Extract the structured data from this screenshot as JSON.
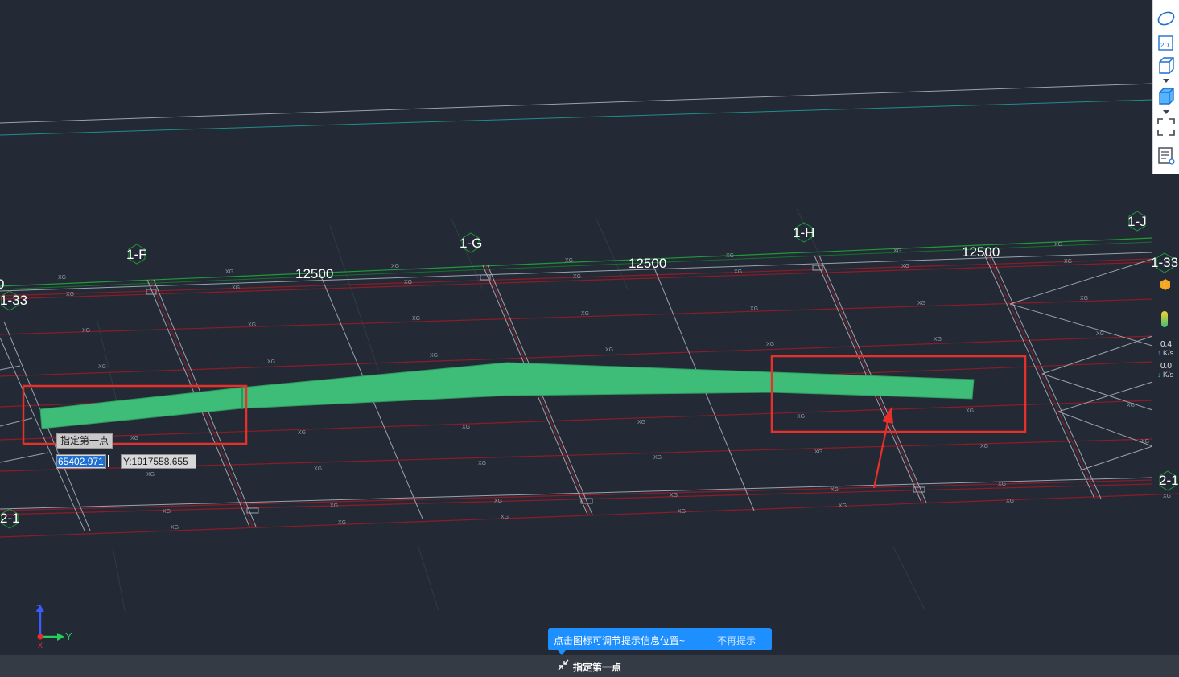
{
  "grid_labels": {
    "col_f": "1-F",
    "col_g": "1-G",
    "col_h": "1-H",
    "col_j": "1-J",
    "row_33_left": "1-33",
    "row_33_right": "1-33",
    "row_21_left": "2-1",
    "row_21_right": "2-1",
    "edge_left": "0"
  },
  "dimensions": [
    "12500",
    "12500",
    "12500"
  ],
  "member_label": "XG",
  "speed": {
    "up_value": "0.4",
    "up_unit": "K/s",
    "down_value": "0.0",
    "down_unit": "K/s"
  },
  "dynamic_input": {
    "prompt": "指定第一点",
    "x_value": "65402.971",
    "y_value": "Y:1917558.655"
  },
  "tip": {
    "message": "点击图标可调节提示信息位置~",
    "dismiss": "不再提示"
  },
  "command_line": {
    "prompt": "指定第一点"
  },
  "axes": {
    "z": "Z",
    "y": "Y",
    "x": "X"
  },
  "toolbar": {
    "view_2d_label": "2D"
  },
  "colors": {
    "background": "#232a35",
    "highlight_fill": "#3ebd78",
    "annotation_red": "#e8302a",
    "tip_blue": "#1e8fff",
    "beam_red": "#8c1c28",
    "gridline_gray": "#9aa3ad"
  },
  "icons": [
    "orbit-icon",
    "view-2d-icon",
    "cube-wireframe-icon",
    "cube-shaded-icon",
    "fullscreen-icon",
    "property-list-icon",
    "warning-badge-icon",
    "thermometer-icon",
    "axis-gizmo-icon",
    "tip-position-icon"
  ]
}
